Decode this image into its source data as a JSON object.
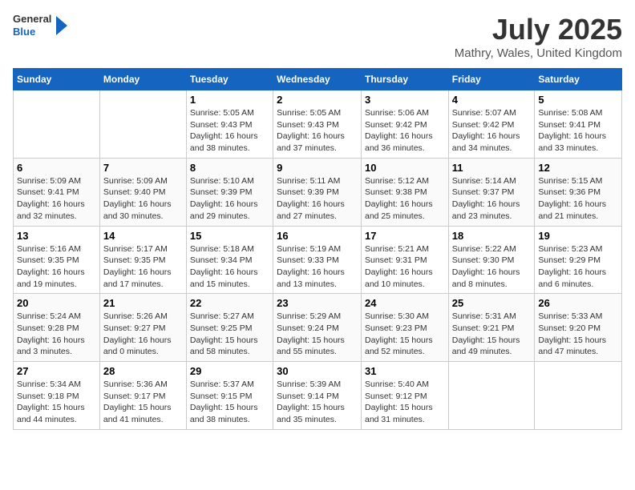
{
  "header": {
    "logo_general": "General",
    "logo_blue": "Blue",
    "month_title": "July 2025",
    "location": "Mathry, Wales, United Kingdom"
  },
  "weekdays": [
    "Sunday",
    "Monday",
    "Tuesday",
    "Wednesday",
    "Thursday",
    "Friday",
    "Saturday"
  ],
  "weeks": [
    [
      {
        "day": "",
        "text": ""
      },
      {
        "day": "",
        "text": ""
      },
      {
        "day": "1",
        "text": "Sunrise: 5:05 AM\nSunset: 9:43 PM\nDaylight: 16 hours and 38 minutes."
      },
      {
        "day": "2",
        "text": "Sunrise: 5:05 AM\nSunset: 9:43 PM\nDaylight: 16 hours and 37 minutes."
      },
      {
        "day": "3",
        "text": "Sunrise: 5:06 AM\nSunset: 9:42 PM\nDaylight: 16 hours and 36 minutes."
      },
      {
        "day": "4",
        "text": "Sunrise: 5:07 AM\nSunset: 9:42 PM\nDaylight: 16 hours and 34 minutes."
      },
      {
        "day": "5",
        "text": "Sunrise: 5:08 AM\nSunset: 9:41 PM\nDaylight: 16 hours and 33 minutes."
      }
    ],
    [
      {
        "day": "6",
        "text": "Sunrise: 5:09 AM\nSunset: 9:41 PM\nDaylight: 16 hours and 32 minutes."
      },
      {
        "day": "7",
        "text": "Sunrise: 5:09 AM\nSunset: 9:40 PM\nDaylight: 16 hours and 30 minutes."
      },
      {
        "day": "8",
        "text": "Sunrise: 5:10 AM\nSunset: 9:39 PM\nDaylight: 16 hours and 29 minutes."
      },
      {
        "day": "9",
        "text": "Sunrise: 5:11 AM\nSunset: 9:39 PM\nDaylight: 16 hours and 27 minutes."
      },
      {
        "day": "10",
        "text": "Sunrise: 5:12 AM\nSunset: 9:38 PM\nDaylight: 16 hours and 25 minutes."
      },
      {
        "day": "11",
        "text": "Sunrise: 5:14 AM\nSunset: 9:37 PM\nDaylight: 16 hours and 23 minutes."
      },
      {
        "day": "12",
        "text": "Sunrise: 5:15 AM\nSunset: 9:36 PM\nDaylight: 16 hours and 21 minutes."
      }
    ],
    [
      {
        "day": "13",
        "text": "Sunrise: 5:16 AM\nSunset: 9:35 PM\nDaylight: 16 hours and 19 minutes."
      },
      {
        "day": "14",
        "text": "Sunrise: 5:17 AM\nSunset: 9:35 PM\nDaylight: 16 hours and 17 minutes."
      },
      {
        "day": "15",
        "text": "Sunrise: 5:18 AM\nSunset: 9:34 PM\nDaylight: 16 hours and 15 minutes."
      },
      {
        "day": "16",
        "text": "Sunrise: 5:19 AM\nSunset: 9:33 PM\nDaylight: 16 hours and 13 minutes."
      },
      {
        "day": "17",
        "text": "Sunrise: 5:21 AM\nSunset: 9:31 PM\nDaylight: 16 hours and 10 minutes."
      },
      {
        "day": "18",
        "text": "Sunrise: 5:22 AM\nSunset: 9:30 PM\nDaylight: 16 hours and 8 minutes."
      },
      {
        "day": "19",
        "text": "Sunrise: 5:23 AM\nSunset: 9:29 PM\nDaylight: 16 hours and 6 minutes."
      }
    ],
    [
      {
        "day": "20",
        "text": "Sunrise: 5:24 AM\nSunset: 9:28 PM\nDaylight: 16 hours and 3 minutes."
      },
      {
        "day": "21",
        "text": "Sunrise: 5:26 AM\nSunset: 9:27 PM\nDaylight: 16 hours and 0 minutes."
      },
      {
        "day": "22",
        "text": "Sunrise: 5:27 AM\nSunset: 9:25 PM\nDaylight: 15 hours and 58 minutes."
      },
      {
        "day": "23",
        "text": "Sunrise: 5:29 AM\nSunset: 9:24 PM\nDaylight: 15 hours and 55 minutes."
      },
      {
        "day": "24",
        "text": "Sunrise: 5:30 AM\nSunset: 9:23 PM\nDaylight: 15 hours and 52 minutes."
      },
      {
        "day": "25",
        "text": "Sunrise: 5:31 AM\nSunset: 9:21 PM\nDaylight: 15 hours and 49 minutes."
      },
      {
        "day": "26",
        "text": "Sunrise: 5:33 AM\nSunset: 9:20 PM\nDaylight: 15 hours and 47 minutes."
      }
    ],
    [
      {
        "day": "27",
        "text": "Sunrise: 5:34 AM\nSunset: 9:18 PM\nDaylight: 15 hours and 44 minutes."
      },
      {
        "day": "28",
        "text": "Sunrise: 5:36 AM\nSunset: 9:17 PM\nDaylight: 15 hours and 41 minutes."
      },
      {
        "day": "29",
        "text": "Sunrise: 5:37 AM\nSunset: 9:15 PM\nDaylight: 15 hours and 38 minutes."
      },
      {
        "day": "30",
        "text": "Sunrise: 5:39 AM\nSunset: 9:14 PM\nDaylight: 15 hours and 35 minutes."
      },
      {
        "day": "31",
        "text": "Sunrise: 5:40 AM\nSunset: 9:12 PM\nDaylight: 15 hours and 31 minutes."
      },
      {
        "day": "",
        "text": ""
      },
      {
        "day": "",
        "text": ""
      }
    ]
  ]
}
